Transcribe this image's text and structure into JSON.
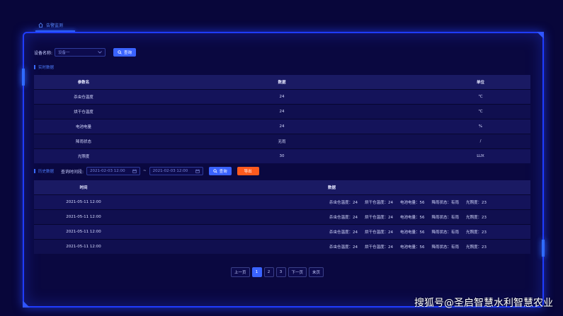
{
  "tab": {
    "label": "告警监测"
  },
  "filter": {
    "label": "设备名称:",
    "select_value": "设备一",
    "query_label": "查询"
  },
  "realtime": {
    "title": "实时数据",
    "headers": [
      "参数名",
      "数据",
      "单位"
    ],
    "rows": [
      [
        "杀虫仓温度",
        "24",
        "℃"
      ],
      [
        "烘干仓温度",
        "24",
        "℃"
      ],
      [
        "电池电量",
        "24",
        "%"
      ],
      [
        "降雨状态",
        "无雨",
        "/"
      ],
      [
        "光照度",
        "30",
        "LUX"
      ]
    ]
  },
  "history": {
    "title": "历史数据",
    "time_label": "查询时间段:",
    "start": "2021-02-03  12:00",
    "separator": "~",
    "end": "2021-02-03  12:00",
    "query_label": "查询",
    "export_label": "导出",
    "headers": [
      "时间",
      "数据"
    ],
    "rows": [
      {
        "time": "2021-05-11    12:00",
        "items": [
          "杀虫仓温度：24",
          "烘干仓温度：24",
          "电池电量：56",
          "降雨状态：有雨",
          "光照度：23"
        ]
      },
      {
        "time": "2021-05-11    12:00",
        "items": [
          "杀虫仓温度：24",
          "烘干仓温度：24",
          "电池电量：56",
          "降雨状态：有雨",
          "光照度：23"
        ]
      },
      {
        "time": "2021-05-11    12:00",
        "items": [
          "杀虫仓温度：24",
          "烘干仓温度：24",
          "电池电量：56",
          "降雨状态：有雨",
          "光照度：23"
        ]
      },
      {
        "time": "2021-05-11    12:00",
        "items": [
          "杀虫仓温度：24",
          "烘干仓温度：24",
          "电池电量：56",
          "降雨状态：有雨",
          "光照度：23"
        ]
      }
    ]
  },
  "pagination": {
    "prev": "上一页",
    "pages": [
      "1",
      "2",
      "3"
    ],
    "next": "下一页",
    "last": "末页"
  },
  "watermark": "搜狐号@圣启智慧水利智慧农业",
  "colors": {
    "accent": "#3a63ff",
    "export": "#ff5a1e",
    "background": "#08063a"
  }
}
